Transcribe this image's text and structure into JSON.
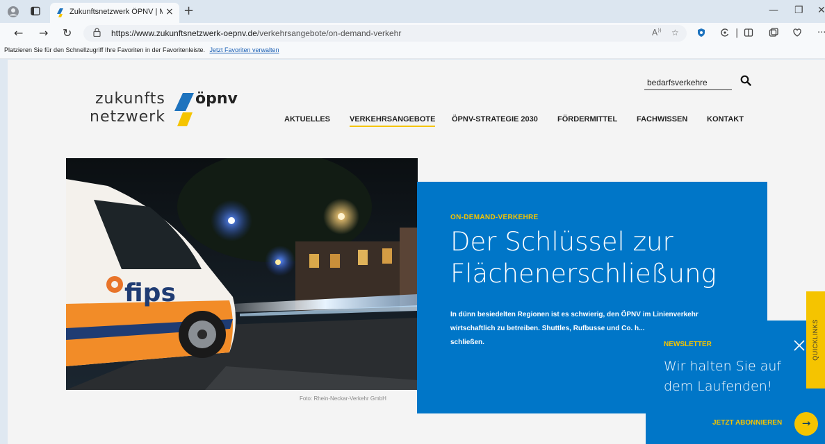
{
  "browser": {
    "tab_title": "Zukunftsnetzwerk ÖPNV | Mit On",
    "tab_close": "×",
    "new_tab": "+",
    "url_host": "https://www.zukunftsnetzwerk-oepnv.de",
    "url_path": "/verkehrsangebote/on-demand-verkehr",
    "favorites_hint": "Platzieren Sie für den Schnellzugriff Ihre Favoriten in der Favoritenleiste.",
    "favorites_link": "Jetzt Favoriten verwalten",
    "icons": [
      "profile-icon",
      "tab-actions-icon",
      "back-icon",
      "forward-icon",
      "refresh-icon",
      "lock-icon",
      "read-aloud-icon",
      "favorite-star-icon",
      "extension-icon",
      "split-screen-icon",
      "favorites-icon",
      "collections-icon",
      "more-icon"
    ]
  },
  "site": {
    "logo": {
      "word1": "zukunfts",
      "word2": "netzwerk",
      "word3": "öpnv",
      "colors": {
        "blue": "#1e73be",
        "yellow": "#f5c400"
      }
    },
    "search_value": "bedarfsverkehre",
    "nav": [
      "AKTUELLES",
      "VERKEHRSANGEBOTE",
      "ÖPNV-STRATEGIE 2030",
      "FÖRDERMITTEL",
      "FACHWISSEN",
      "KONTAKT"
    ],
    "active_nav": "VERKEHRSANGEBOTE"
  },
  "hero": {
    "kicker": "ON-DEMAND-VERKEHRE",
    "headline": "Der Schlüssel zur Flächenerschließung",
    "lead": "In dünn besiedelten Regionen ist es schwierig, den ÖPNV im Linienverkehr wirtschaftlich zu betreiben. Shuttles, Rufbusse und Co. h... Angebotslücken zu schließen.",
    "photo_credit": "Foto: Rhein-Neckar-Verkehr GmbH",
    "image_brand_text": "fips"
  },
  "newsletter": {
    "label": "NEWSLETTER",
    "text": "Wir halten Sie auf dem Laufenden!",
    "cta": "JETZT ABONNIEREN",
    "arrow": "→"
  },
  "quicklinks": {
    "label": "QUICKLINKS"
  },
  "colors": {
    "brand_blue": "#0076c8",
    "accent_yellow": "#f5c400"
  }
}
